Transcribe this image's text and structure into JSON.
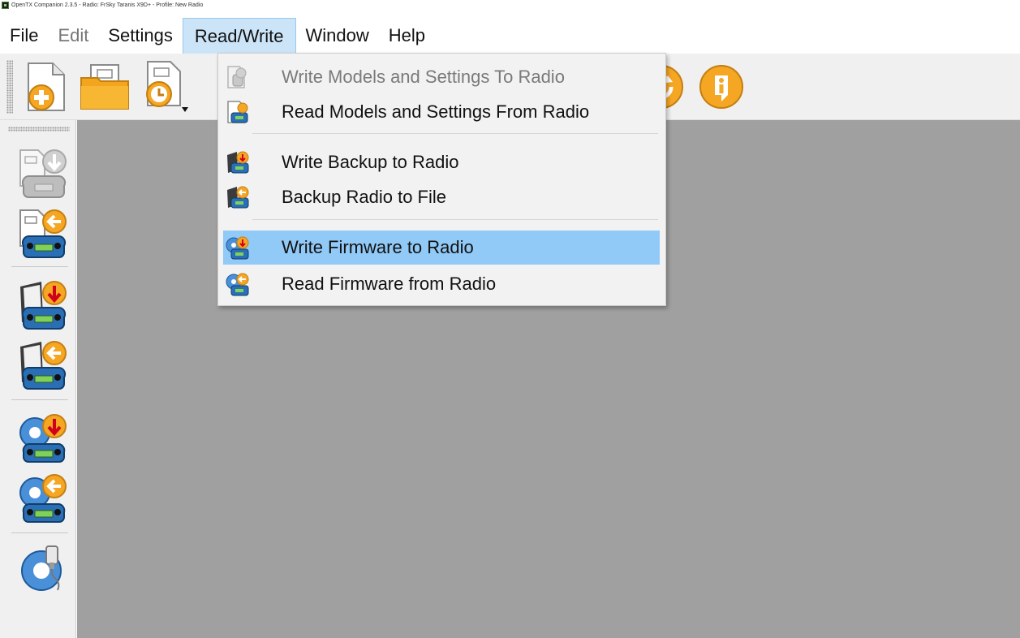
{
  "window": {
    "title": "OpenTX Companion 2.3.5 - Radio: FrSky Taranis X9D+ - Profile: New Radio"
  },
  "menubar": {
    "items": [
      {
        "label": "File"
      },
      {
        "label": "Edit"
      },
      {
        "label": "Settings"
      },
      {
        "label": "Read/Write"
      },
      {
        "label": "Window"
      },
      {
        "label": "Help"
      }
    ]
  },
  "readwrite_menu": {
    "items": [
      {
        "label": "Write Models and Settings To Radio",
        "enabled": false
      },
      {
        "label": "Read Models and Settings From Radio",
        "enabled": true
      },
      {
        "label": "Write Backup to Radio",
        "enabled": true
      },
      {
        "label": "Backup Radio to File",
        "enabled": true
      },
      {
        "label": "Write Firmware to Radio",
        "enabled": true,
        "highlighted": true
      },
      {
        "label": "Read Firmware from Radio",
        "enabled": true
      }
    ]
  },
  "toolbar": {
    "icons": [
      "new-file-icon",
      "open-folder-icon",
      "recent-files-icon",
      "compare-models-icon",
      "sd-sync-icon",
      "check-updates-icon",
      "about-icon"
    ]
  },
  "leftbar": {
    "icons": [
      "write-models-icon",
      "read-models-icon",
      "write-backup-icon",
      "backup-radio-icon",
      "write-firmware-icon",
      "read-firmware-icon",
      "radio-settings-icon"
    ]
  },
  "colors": {
    "menu_highlight": "#91c9f7",
    "menu_open": "#cce4f7",
    "mdi_background": "#a0a0a0",
    "accent_orange": "#f5a623"
  }
}
